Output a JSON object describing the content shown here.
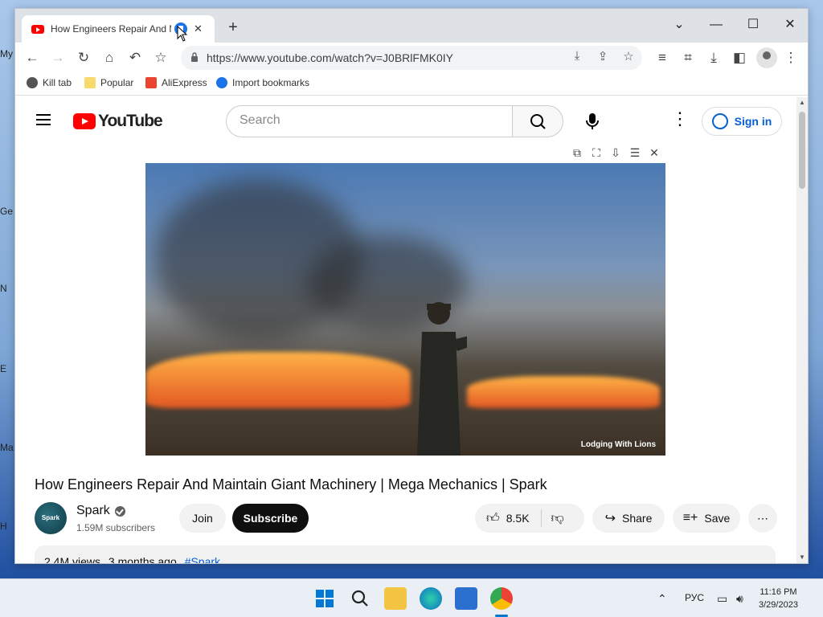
{
  "browser": {
    "tab_title": "How Engineers Repair And M",
    "new_tab": "+",
    "url": "https://www.youtube.com/watch?v=J0BRlFMK0IY",
    "bookmarks": [
      "Kill tab",
      "Popular",
      "AliExpress",
      "Import bookmarks"
    ]
  },
  "youtube": {
    "logo": "YouTube",
    "search_placeholder": "Search",
    "sign_in": "Sign in",
    "video_watermark": "Lodging With Lions",
    "video_title": "How Engineers Repair And Maintain Giant Machinery | Mega Mechanics | Spark",
    "channel_name": "Spark",
    "channel_avatar_text": "Spark",
    "subscribers": "1.59M subscribers",
    "join": "Join",
    "subscribe": "Subscribe",
    "likes": "8.5K",
    "share": "Share",
    "save": "Save",
    "views": "2.4M views",
    "age": "3 months ago",
    "hashtag": "#Spark"
  },
  "taskbar": {
    "language": "РУС",
    "time": "11:16 PM",
    "date": "3/29/2023"
  },
  "colors": {
    "accent": "#065fd4",
    "brand": "#ff0000"
  }
}
